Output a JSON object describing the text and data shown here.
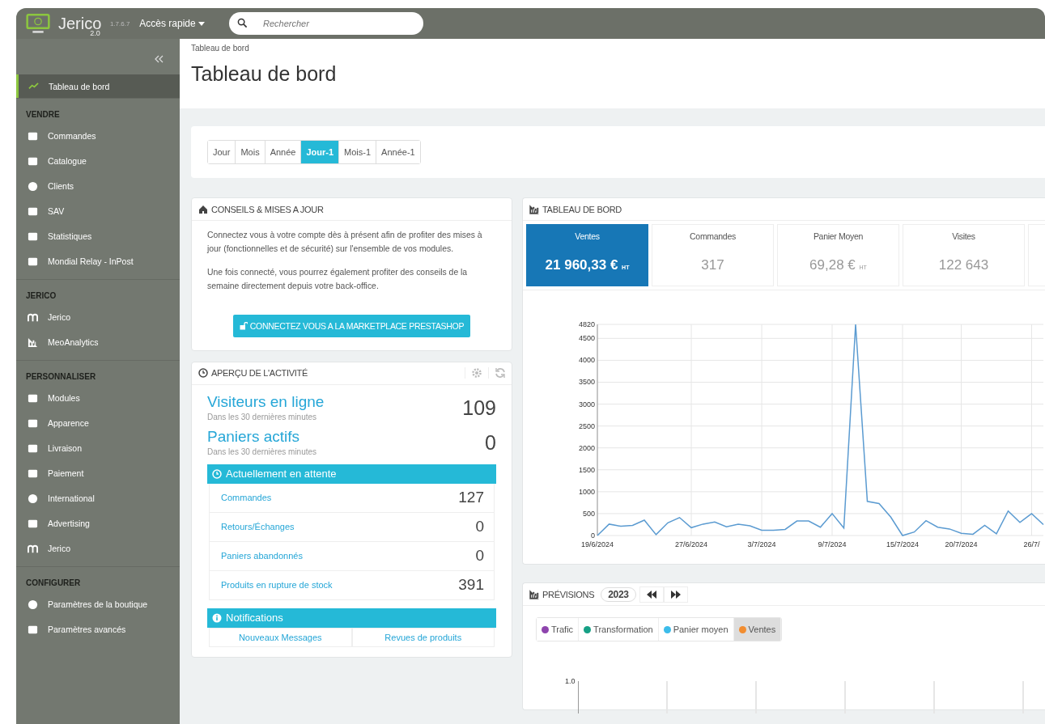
{
  "topbar": {
    "logo": "Jerico",
    "logo_sub": "2.0",
    "version": "1.7.6.7",
    "quick_access": "Accès rapide",
    "search": {
      "placeholder": "Rechercher"
    }
  },
  "sidebar": {
    "active_item": {
      "label": "Tableau de bord",
      "selected": true
    },
    "sections": [
      {
        "title": "VENDRE",
        "items": [
          "Commandes",
          "Catalogue",
          "Clients",
          "SAV",
          "Statistiques",
          "Mondial Relay - InPost"
        ]
      },
      {
        "title": "JERICO",
        "items": [
          "Jerico",
          "MeoAnalytics"
        ]
      },
      {
        "title": "PERSONNALISER",
        "items": [
          "Modules",
          "Apparence",
          "Livraison",
          "Paiement",
          "International",
          "Advertising",
          "Jerico"
        ]
      },
      {
        "title": "CONFIGURER",
        "items": [
          "Paramètres de la boutique",
          "Paramètres avancés"
        ]
      }
    ]
  },
  "breadcrumb": "Tableau de bord",
  "page_title": "Tableau de bord",
  "periods": [
    {
      "label": "Jour",
      "selected": false
    },
    {
      "label": "Mois",
      "selected": false
    },
    {
      "label": "Année",
      "selected": false
    },
    {
      "label": "Jour-1",
      "selected": true
    },
    {
      "label": "Mois-1",
      "selected": false
    },
    {
      "label": "Année-1",
      "selected": false
    }
  ],
  "tips_panel": {
    "title": "CONSEILS & MISES A JOUR",
    "paragraphs": [
      "Connectez vous à votre compte dès à présent afin de profiter des mises à jour (fonctionnelles et de sécurité) sur l'ensemble de vos modules.",
      "Une fois connecté, vous pourrez également profiter des conseils de la semaine directement depuis votre back-office."
    ],
    "button": "CONNECTEZ VOUS A LA MARKETPLACE PRESTASHOP"
  },
  "activity_panel": {
    "title": "APERÇU DE L'ACTIVITÉ",
    "stats": [
      {
        "label": "Visiteurs en ligne",
        "sub": "Dans les 30 dernières minutes",
        "value": "109"
      },
      {
        "label": "Paniers actifs",
        "sub": "Dans les 30 dernières minutes",
        "value": "0"
      }
    ],
    "pending": {
      "title": "Actuellement en attente",
      "rows": [
        {
          "label": "Commandes",
          "value": "127"
        },
        {
          "label": "Retours/Échanges",
          "value": "0"
        },
        {
          "label": "Paniers abandonnés",
          "value": "0"
        },
        {
          "label": "Produits en rupture de stock",
          "value": "391"
        }
      ]
    },
    "notifications": {
      "title": "Notifications",
      "tabs": [
        "Nouveaux Messages",
        "Revues de produits"
      ]
    }
  },
  "dashboard_panel": {
    "title": "TABLEAU DE BORD",
    "kpis": [
      {
        "label": "Ventes",
        "value": "21 960,33 €",
        "unit": "HT",
        "selected": true
      },
      {
        "label": "Commandes",
        "value": "317",
        "selected": false
      },
      {
        "label": "Panier Moyen",
        "value": "69,28 €",
        "unit": "HT",
        "selected": false
      },
      {
        "label": "Visites",
        "value": "122 643",
        "selected": false
      }
    ],
    "chart_data": {
      "type": "line",
      "grid": true,
      "ylim": [
        0,
        4820
      ],
      "yticks": [
        0,
        500,
        1000,
        1500,
        2000,
        2500,
        3000,
        3500,
        4000,
        4500,
        4820
      ],
      "categories": [
        "19/6/2024",
        null,
        null,
        null,
        null,
        null,
        null,
        null,
        "27/6/2024",
        null,
        null,
        null,
        null,
        null,
        "3/7/2024",
        null,
        null,
        null,
        null,
        null,
        "9/7/2024",
        null,
        null,
        null,
        null,
        null,
        "15/7/2024",
        null,
        null,
        null,
        null,
        "20/7/2024",
        null,
        null,
        null,
        null,
        null,
        "26/7/",
        null
      ],
      "series": [
        {
          "color": "#5b9bd1",
          "values": [
            0,
            260,
            210,
            230,
            350,
            20,
            290,
            410,
            180,
            260,
            310,
            200,
            260,
            220,
            120,
            120,
            140,
            330,
            330,
            190,
            500,
            170,
            4820,
            780,
            730,
            420,
            0,
            80,
            340,
            190,
            150,
            50,
            30,
            230,
            40,
            560,
            300,
            500,
            250
          ]
        }
      ]
    }
  },
  "forecast_panel": {
    "title": "PRÉVISIONS",
    "year": "2023",
    "legend": [
      {
        "label": "Trafic",
        "color": "#8e44ad",
        "selected": false
      },
      {
        "label": "Transformation",
        "color": "#16a085",
        "selected": false
      },
      {
        "label": "Panier moyen",
        "color": "#3cbcea",
        "selected": false
      },
      {
        "label": "Ventes",
        "color": "#f28d30",
        "selected": true
      }
    ],
    "y_tick": "1.0"
  }
}
